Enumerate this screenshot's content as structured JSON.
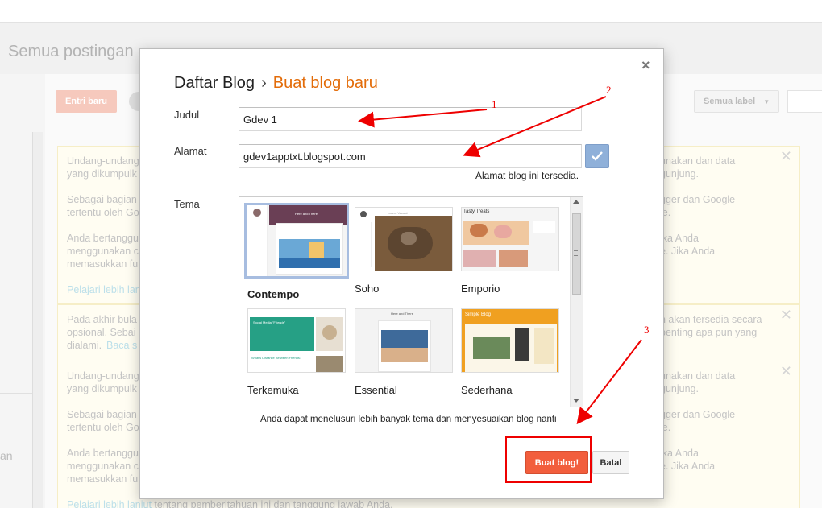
{
  "background": {
    "page_title": "Semua postingan",
    "new_entry_button": "Entri baru",
    "label_filter": "Semua label",
    "left_bottom_text": "an",
    "notices": [
      {
        "p1": "Undang-undang",
        "p1_right": "unakan dan data",
        "p1b": "yang dikumpulk",
        "p1b_right": "gunjung.",
        "p2": "Sebagai bagian",
        "p2_right": "gger dan Google",
        "p2b": "tertentu oleh Go",
        "p2b_right": "le.",
        "p3": "Anda bertanggu",
        "p3_right": "ika Anda",
        "p3b": "menggunakan c",
        "p3b_right": "e. Jika Anda",
        "p3c": "memasukkan fu",
        "link": "Pelajari lebih lan"
      },
      {
        "p1": "Pada akhir bula",
        "p1_right": "n akan tersedia secara",
        "p1b": "opsional. Sebai",
        "p1b_right": "penting apa pun yang",
        "p1c": "dialami.",
        "link": "Baca s"
      },
      {
        "p1": "Undang-undang",
        "p1_right": "unakan dan data",
        "p1b": "yang dikumpulk",
        "p1b_right": "gunjung.",
        "p2": "Sebagai bagian",
        "p2_right": "gger dan Google",
        "p2b": "tertentu oleh Go",
        "p2b_right": "le.",
        "p3": "Anda bertanggu",
        "p3_right": "ika Anda",
        "p3b": "menggunakan c",
        "p3b_right": "e. Jika Anda",
        "p3c": "memasukkan fu",
        "link": "Pelajari lebih lanjut",
        "link_tail": "tentang pemberitahuan ini dan tanggung jawab Anda."
      }
    ]
  },
  "dialog": {
    "breadcrumb_parent": "Daftar Blog",
    "breadcrumb_sep": "›",
    "breadcrumb_current": "Buat blog baru",
    "close_glyph": "×",
    "title_label": "Judul",
    "title_value": "Gdev 1",
    "address_label": "Alamat",
    "address_value": "gdev1apptxt.blogspot.com",
    "address_status": "Alamat blog ini tersedia.",
    "theme_label": "Tema",
    "themes": [
      {
        "name": "Contempo",
        "selected": true
      },
      {
        "name": "Soho",
        "selected": false
      },
      {
        "name": "Emporio",
        "selected": false
      },
      {
        "name": "Terkemuka",
        "selected": false
      },
      {
        "name": "Essential",
        "selected": false
      },
      {
        "name": "Sederhana",
        "selected": false
      }
    ],
    "theme_thumb_text": {
      "contempo_title": "Here and There",
      "soho_title": "Lorem Vacuat",
      "emporio_title": "Tasty Treats",
      "terkemuka_title": "Social Media \"Friends\"",
      "terkemuka_sub": "What's Distance Between Friends?",
      "essential_title": "Here and There",
      "sederhana_title": "Simple Blog"
    },
    "tip": "Anda dapat menelusuri lebih banyak tema dan menyesuaikan blog nanti",
    "create_button": "Buat blog!",
    "cancel_button": "Batal"
  },
  "annotations": [
    "1",
    "2",
    "3"
  ],
  "colors": {
    "accent_orange": "#e36c09",
    "create_button": "#f25e3d",
    "annotation_red": "#e00000"
  }
}
